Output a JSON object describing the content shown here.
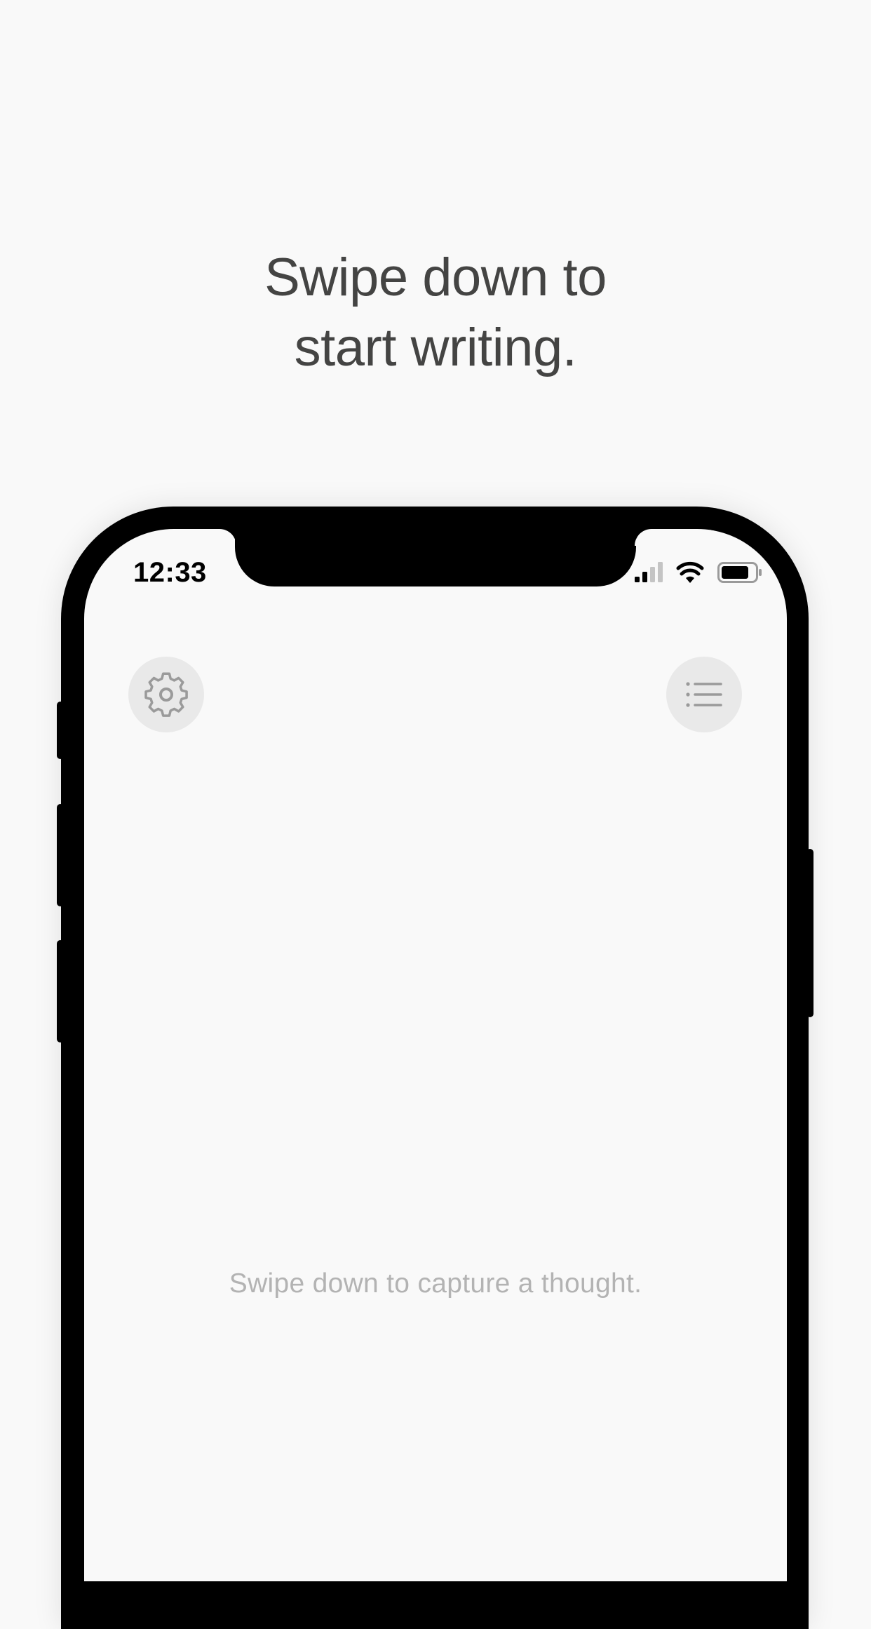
{
  "headline": {
    "line1": "Swipe down to",
    "line2": "start writing."
  },
  "status_bar": {
    "time": "12:33",
    "icons": [
      "signal-icon",
      "wifi-icon",
      "battery-icon"
    ]
  },
  "toolbar": {
    "settings_icon": "gear-icon",
    "list_icon": "list-icon"
  },
  "empty_state": {
    "hint": "Swipe down to capture a thought."
  },
  "colors": {
    "background": "#f9f9f9",
    "headline_text": "#444443",
    "hint_text": "#b3b3b3",
    "icon_button_bg": "#e9e9e9",
    "icon_stroke": "#9a9a9a",
    "device_frame": "#000000"
  }
}
